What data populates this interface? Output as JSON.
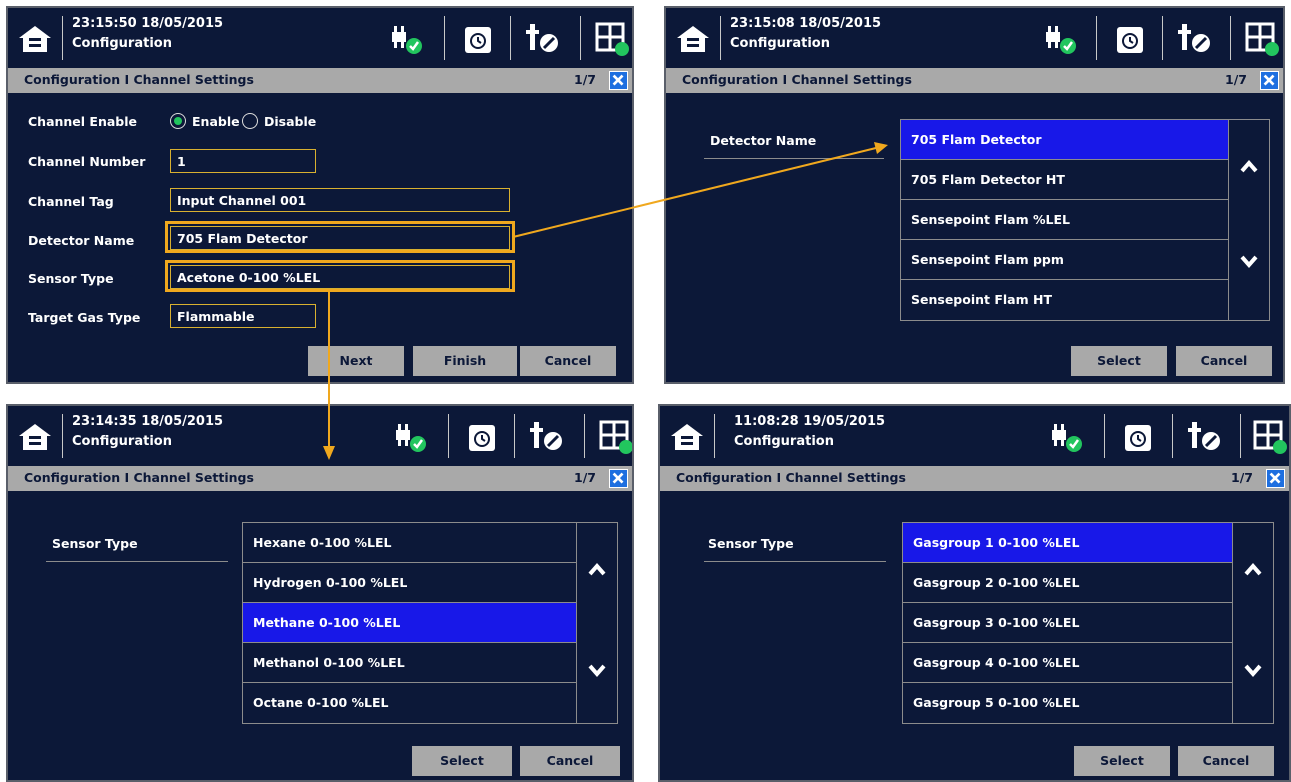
{
  "screens": [
    {
      "time": "23:15:50 18/05/2015",
      "crumb": "Configuration",
      "title": "Configuration I Channel Settings",
      "page": "1/7",
      "form": {
        "enable_label": "Channel Enable",
        "enable_opt": "Enable",
        "disable_opt": "Disable",
        "number_label": "Channel Number",
        "number_value": "1",
        "tag_label": "Channel Tag",
        "tag_value": "Input Channel 001",
        "detector_label": "Detector Name",
        "detector_value": "705 Flam Detector",
        "sensor_label": "Sensor Type",
        "sensor_value": "Acetone 0-100 %LEL",
        "gas_label": "Target Gas Type",
        "gas_value": "Flammable"
      },
      "buttons": [
        "Next",
        "Finish",
        "Cancel"
      ]
    },
    {
      "time": "23:15:08 18/05/2015",
      "crumb": "Configuration",
      "title": "Configuration I Channel Settings",
      "page": "1/7",
      "field_label": "Detector Name",
      "items": [
        "705 Flam Detector",
        "705 Flam Detector HT",
        "Sensepoint Flam %LEL",
        "Sensepoint Flam ppm",
        "Sensepoint Flam HT"
      ],
      "buttons": [
        "Select",
        "Cancel"
      ]
    },
    {
      "time": "23:14:35 18/05/2015",
      "crumb": "Configuration",
      "title": "Configuration I Channel Settings",
      "page": "1/7",
      "field_label": "Sensor Type",
      "items": [
        "Hexane 0-100 %LEL",
        "Hydrogen 0-100 %LEL",
        "Methane 0-100 %LEL",
        "Methanol 0-100 %LEL",
        "Octane 0-100 %LEL"
      ],
      "buttons": [
        "Select",
        "Cancel"
      ]
    },
    {
      "time": "11:08:28 19/05/2015",
      "crumb": "Configuration",
      "title": "Configuration I Channel Settings",
      "page": "1/7",
      "field_label": "Sensor Type",
      "items": [
        "Gasgroup 1 0-100 %LEL",
        "Gasgroup 2 0-100 %LEL",
        "Gasgroup 3 0-100 %LEL",
        "Gasgroup 4 0-100 %LEL",
        "Gasgroup 5 0-100 %LEL"
      ],
      "buttons": [
        "Select",
        "Cancel"
      ]
    }
  ],
  "icons": [
    "home-icon",
    "power-ok-icon",
    "schedule-icon",
    "maintenance-icon",
    "grid-menu-icon",
    "close-icon",
    "scroll-up-icon",
    "scroll-down-icon"
  ],
  "colors": {
    "background": "#0c1838",
    "selected": "#1818e8",
    "highlight": "#f0a81e",
    "titlebar": "#a9a9a9"
  }
}
